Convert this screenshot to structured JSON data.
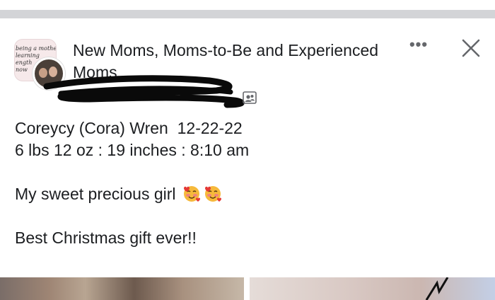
{
  "group": {
    "name": "New Moms, Moms-to-Be and Experienced Moms",
    "avatar_text": "being a mothe\nlearning\nength\nnow"
  },
  "header": {
    "more_label": "•••",
    "close_icon": "close-icon"
  },
  "post": {
    "lines": [
      "Coreycy (Cora) Wren  12-22-22",
      "6 lbs 12 oz : 19 inches : 8:10 am",
      "",
      "My sweet precious girl ",
      "",
      "Best Christmas gift ever!!"
    ]
  },
  "colors": {
    "text": "#1c1e21",
    "secondary": "#65676b",
    "divider": "#d3d4d7"
  }
}
